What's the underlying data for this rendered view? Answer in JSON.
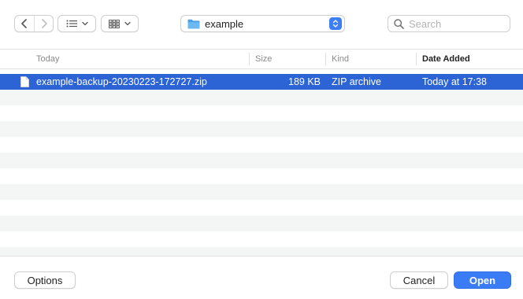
{
  "toolbar": {
    "location": "example",
    "search_placeholder": "Search"
  },
  "columns": {
    "name": "Today",
    "size": "Size",
    "kind": "Kind",
    "date_added": "Date Added"
  },
  "files": [
    {
      "name": "example-backup-20230223-172727.zip",
      "size": "189 KB",
      "kind": "ZIP archive",
      "date_added": "Today at 17:38",
      "selected": true
    }
  ],
  "footer": {
    "options_label": "Options",
    "cancel_label": "Cancel",
    "open_label": "Open"
  },
  "colors": {
    "selection": "#2c63d5",
    "primary_button": "#3a7cf5",
    "folder": "#5aaaf0"
  },
  "icons": {
    "back": "chevron-left-icon",
    "forward": "chevron-right-icon",
    "list_view": "list-icon",
    "icon_view": "grid-icon",
    "folder": "folder-icon",
    "stepper": "up-down-chevron-icon",
    "search": "magnifier-icon",
    "file": "document-icon"
  }
}
